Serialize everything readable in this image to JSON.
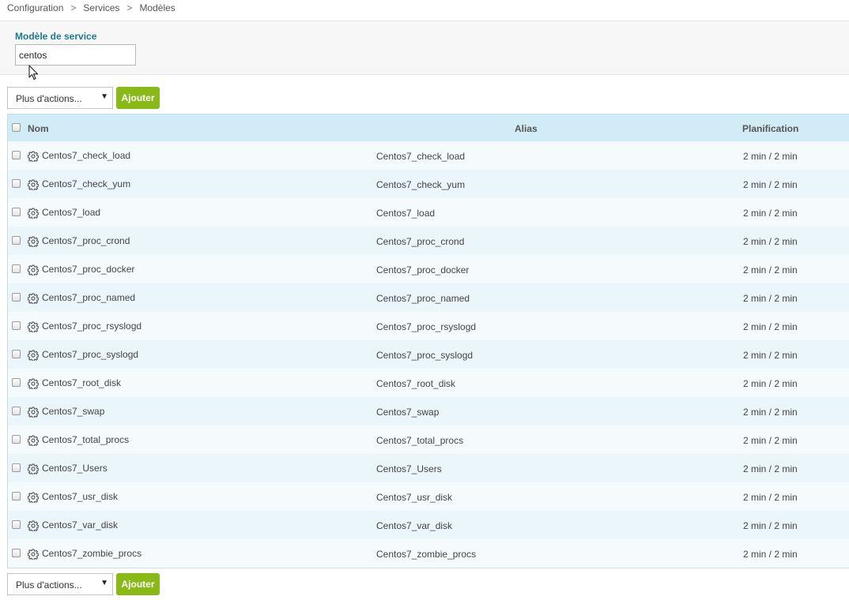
{
  "breadcrumb": [
    "Configuration",
    "Services",
    "Modèles"
  ],
  "breadcrumb_separator": ">",
  "filter": {
    "label": "Modèle de service",
    "value": "centos"
  },
  "actions": {
    "select_label": "Plus d'actions...",
    "select_arrow": "▼",
    "add_label": "Ajouter"
  },
  "table": {
    "headers": {
      "name": "Nom",
      "alias": "Alias",
      "schedule": "Planification"
    },
    "rows": [
      {
        "name": "Centos7_check_load",
        "alias": "Centos7_check_load",
        "schedule": "2 min / 2 min"
      },
      {
        "name": "Centos7_check_yum",
        "alias": "Centos7_check_yum",
        "schedule": "2 min / 2 min"
      },
      {
        "name": "Centos7_load",
        "alias": "Centos7_load",
        "schedule": "2 min / 2 min"
      },
      {
        "name": "Centos7_proc_crond",
        "alias": "Centos7_proc_crond",
        "schedule": "2 min / 2 min"
      },
      {
        "name": "Centos7_proc_docker",
        "alias": "Centos7_proc_docker",
        "schedule": "2 min / 2 min"
      },
      {
        "name": "Centos7_proc_named",
        "alias": "Centos7_proc_named",
        "schedule": "2 min / 2 min"
      },
      {
        "name": "Centos7_proc_rsyslogd",
        "alias": "Centos7_proc_rsyslogd",
        "schedule": "2 min / 2 min"
      },
      {
        "name": "Centos7_proc_syslogd",
        "alias": "Centos7_proc_syslogd",
        "schedule": "2 min / 2 min"
      },
      {
        "name": "Centos7_root_disk",
        "alias": "Centos7_root_disk",
        "schedule": "2 min / 2 min"
      },
      {
        "name": "Centos7_swap",
        "alias": "Centos7_swap",
        "schedule": "2 min / 2 min"
      },
      {
        "name": "Centos7_total_procs",
        "alias": "Centos7_total_procs",
        "schedule": "2 min / 2 min"
      },
      {
        "name": "Centos7_Users",
        "alias": "Centos7_Users",
        "schedule": "2 min / 2 min"
      },
      {
        "name": "Centos7_usr_disk",
        "alias": "Centos7_usr_disk",
        "schedule": "2 min / 2 min"
      },
      {
        "name": "Centos7_var_disk",
        "alias": "Centos7_var_disk",
        "schedule": "2 min / 2 min"
      },
      {
        "name": "Centos7_zombie_procs",
        "alias": "Centos7_zombie_procs",
        "schedule": "2 min / 2 min"
      }
    ]
  },
  "colors": {
    "accent_green": "#88b917",
    "header_blue": "#d1ecf6",
    "label_teal": "#1a7a8a"
  }
}
